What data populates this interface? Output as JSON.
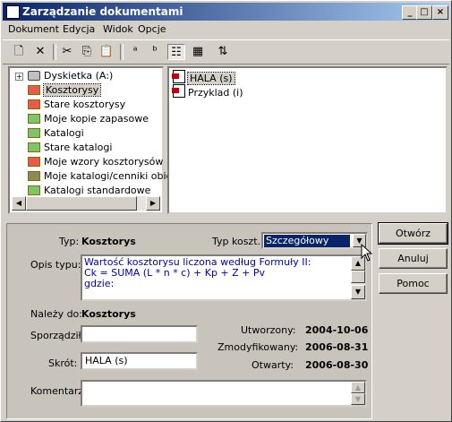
{
  "window": {
    "title": "Zarządzanie dokumentami"
  },
  "titlebar_buttons": {
    "minimize": "_",
    "maximize": "□",
    "close": "×"
  },
  "menu": [
    "Dokument",
    "Edycja",
    "Widok",
    "Opcje"
  ],
  "toolbar": {
    "new_glyph": "🗋",
    "delete_glyph": "✕",
    "cut_glyph": "✂",
    "copy_glyph": "⎘",
    "paste_glyph": "📋",
    "icons_glyph": "ᵃ",
    "small_icons_glyph": "ᵇ",
    "list_glyph": "☷",
    "details_glyph": "▦",
    "sort_glyph": "⇅"
  },
  "tree": {
    "items": [
      {
        "label": "Dyskietka (A:)",
        "icon": "drive",
        "expander": "+"
      },
      {
        "label": "Kosztorysy",
        "icon": "folder-red",
        "selected": true
      },
      {
        "label": "Stare kosztorysy",
        "icon": "folder-red"
      },
      {
        "label": "Moje kopie zapasowe",
        "icon": "folder-green"
      },
      {
        "label": "Katalogi",
        "icon": "folder-green"
      },
      {
        "label": "Stare katalogi",
        "icon": "folder-green"
      },
      {
        "label": "Moje wzory kosztorysów",
        "icon": "folder-red"
      },
      {
        "label": "Moje katalogi/cenniki obie",
        "icon": "folder-blue"
      },
      {
        "label": "Katalogi standardowe",
        "icon": "folder-green"
      }
    ]
  },
  "documents": [
    {
      "label": "HALA (s)",
      "selected": true
    },
    {
      "label": "Przyklad (i)"
    }
  ],
  "details": {
    "typ_label": "Typ:",
    "typ_value": "Kosztorys",
    "typ_koszt_label": "Typ koszt.:",
    "typ_koszt_value": "Szczegółowy",
    "opis_label": "Opis typu:",
    "opis_value": "Wartość kosztorysu liczona według Formuły II:\nCk = SUMA (L * n * c) + Kp + Z + Pv\ngdzie:",
    "nalezy_label": "Należy do:",
    "nalezy_value": "Kosztorys",
    "sporzadzil_label": "Sporządził:",
    "sporzadzil_value": "",
    "skrot_label": "Skrót:",
    "skrot_value": "HALA (s)",
    "komentarz_label": "Komentarz:",
    "komentarz_value": "",
    "utworzony_label": "Utworzony:",
    "utworzony_value": "2004-10-06",
    "zmodyfikowany_label": "Zmodyfikowany:",
    "zmodyfikowany_value": "2006-08-31",
    "otwarty_label": "Otwarty:",
    "otwarty_value": "2006-08-30"
  },
  "buttons": {
    "open": "Otwórz",
    "cancel": "Anuluj",
    "help": "Pomoc"
  },
  "colors": {
    "title_start": "#0a246a",
    "title_end": "#a6caf0",
    "face": "#d4d0c8",
    "link_text": "#0000aa"
  }
}
